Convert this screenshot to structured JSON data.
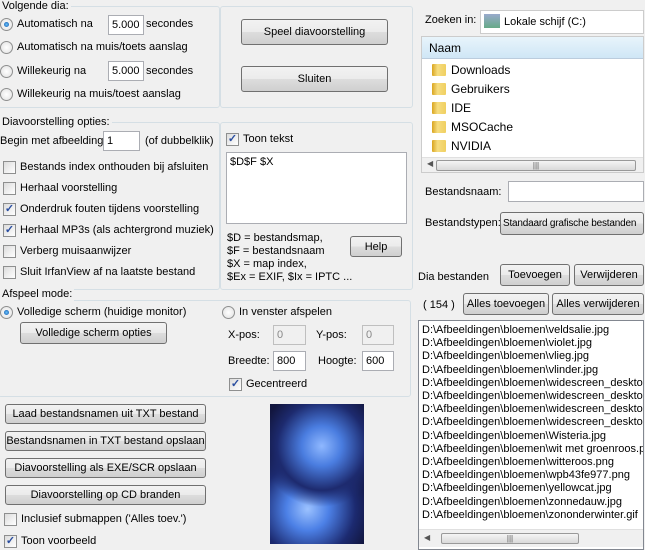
{
  "next_slide": {
    "title": "Volgende dia:",
    "options": [
      {
        "label": "Automatisch na",
        "selected": true,
        "value": "5.000",
        "unit": "secondes"
      },
      {
        "label": "Automatisch na muis/toets aanslag",
        "selected": false
      },
      {
        "label": "Willekeurig na",
        "selected": false,
        "value": "5.000",
        "unit": "secondes"
      },
      {
        "label": "Willekeurig na muis/toest aanslag",
        "selected": false
      }
    ]
  },
  "actions": {
    "play": "Speel diavoorstelling",
    "close": "Sluiten"
  },
  "options": {
    "title": "Diavoorstelling opties:",
    "start_label": "Begin met afbeelding:",
    "start_value": "1",
    "start_hint": "(of dubbelklik)",
    "checkboxes": [
      {
        "label": "Bestands index onthouden bij afsluiten",
        "checked": false
      },
      {
        "label": "Herhaal voorstelling",
        "checked": false
      },
      {
        "label": "Onderdruk fouten tijdens voorstelling",
        "checked": true
      },
      {
        "label": "Herhaal MP3s (als achtergrond muziek)",
        "checked": true
      },
      {
        "label": "Verberg muisaanwijzer",
        "checked": false
      },
      {
        "label": "Sluit IrfanView af na laatste bestand",
        "checked": false
      }
    ]
  },
  "text": {
    "show_label": "Toon tekst",
    "show_checked": true,
    "value": "$D$F $X",
    "help_lines": [
      "$D = bestandsmap,",
      "$F = bestandsnaam",
      "$X = map index,",
      "$Ex = EXIF, $Ix = IPTC ..."
    ],
    "help_button": "Help"
  },
  "playmode": {
    "title": "Afspeel mode:",
    "fullscreen_label": "Volledige scherm (huidige monitor)",
    "fullscreen_selected": true,
    "fullscreen_options": "Volledige scherm opties",
    "window_label": "In venster afspelen",
    "window_selected": false,
    "xpos_label": "X-pos:",
    "xpos": "0",
    "ypos_label": "Y-pos:",
    "ypos": "0",
    "width_label": "Breedte:",
    "width": "800",
    "height_label": "Hoogte:",
    "height": "600",
    "centered_label": "Gecentreerd",
    "centered_checked": true
  },
  "file_buttons": [
    "Laad bestandsnamen uit TXT bestand",
    "Bestandsnamen in TXT bestand opslaan",
    "Diavoorstelling als  EXE/SCR opslaan",
    "Diavoorstelling op CD branden"
  ],
  "include_sub": {
    "label": "Inclusief submappen ('Alles toev.')",
    "checked": false
  },
  "show_preview": {
    "label": "Toon voorbeeld",
    "checked": true
  },
  "browser": {
    "look_in_label": "Zoeken in:",
    "look_in": "Lokale schijf (C:)",
    "column": "Naam",
    "folders": [
      {
        "name": "Downloads",
        "icon": "folder-icon"
      },
      {
        "name": "Gebruikers",
        "icon": "folder-icon"
      },
      {
        "name": "IDE",
        "icon": "folder-icon"
      },
      {
        "name": "MSOCache",
        "icon": "locked-folder-icon"
      },
      {
        "name": "NVIDIA",
        "icon": "folder-icon"
      }
    ],
    "filename_label": "Bestandsnaam:",
    "filename": "",
    "filetypes_label": "Bestandstypen:",
    "filetypes": "Standaard grafische bestanden"
  },
  "slides": {
    "label": "Dia bestanden",
    "count": "( 154 )",
    "add": "Toevoegen",
    "remove": "Verwijderen",
    "add_all": "Alles toevoegen",
    "remove_all": "Alles verwijderen",
    "files": [
      "D:\\Afbeeldingen\\bloemen\\veldsalie.jpg",
      "D:\\Afbeeldingen\\bloemen\\violet.jpg",
      "D:\\Afbeeldingen\\bloemen\\vlieg.jpg",
      "D:\\Afbeeldingen\\bloemen\\vlinder.jpg",
      "D:\\Afbeeldingen\\bloemen\\widescreen_desktop",
      "D:\\Afbeeldingen\\bloemen\\widescreen_desktop",
      "D:\\Afbeeldingen\\bloemen\\widescreen_desktop",
      "D:\\Afbeeldingen\\bloemen\\widescreen_desktop",
      "D:\\Afbeeldingen\\bloemen\\Wisteria.jpg",
      "D:\\Afbeeldingen\\bloemen\\wit met groenroos.pn",
      "D:\\Afbeeldingen\\bloemen\\witteroos.png",
      "D:\\Afbeeldingen\\bloemen\\wpb43fe977.png",
      "D:\\Afbeeldingen\\bloemen\\yellowcat.jpg",
      "D:\\Afbeeldingen\\bloemen\\zonnedauw.jpg",
      "D:\\Afbeeldingen\\bloemen\\zononderwinter.gif"
    ]
  }
}
